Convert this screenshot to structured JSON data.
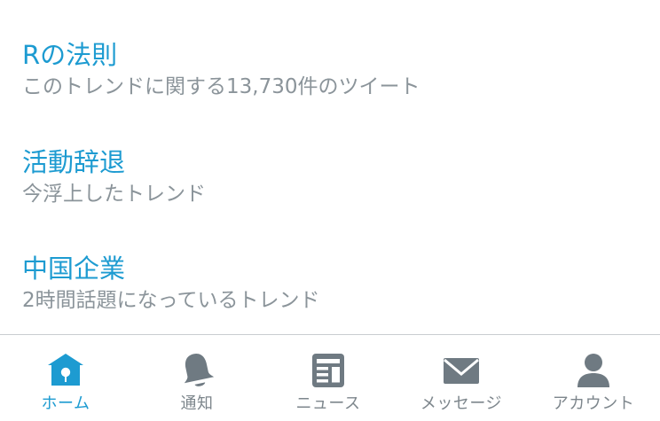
{
  "trends": [
    {
      "title": "Rの法則",
      "meta": "このトレンドに関する13,730件のツイート"
    },
    {
      "title": "活動辞退",
      "meta": "今浮上したトレンド"
    },
    {
      "title": "中国企業",
      "meta": "2時間話題になっているトレンド"
    }
  ],
  "tab_bar": {
    "tabs": [
      {
        "label": "ホーム",
        "icon": "home-icon",
        "active": true
      },
      {
        "label": "通知",
        "icon": "bell-icon",
        "active": false
      },
      {
        "label": "ニュース",
        "icon": "news-icon",
        "active": false
      },
      {
        "label": "メッセージ",
        "icon": "envelope-icon",
        "active": false
      },
      {
        "label": "アカウント",
        "icon": "person-icon",
        "active": false
      }
    ]
  },
  "colors": {
    "accent": "#1d9bd1",
    "secondary_text": "#8b949a",
    "inactive_icon": "#6f7a82",
    "divider": "#c9cdd0"
  }
}
